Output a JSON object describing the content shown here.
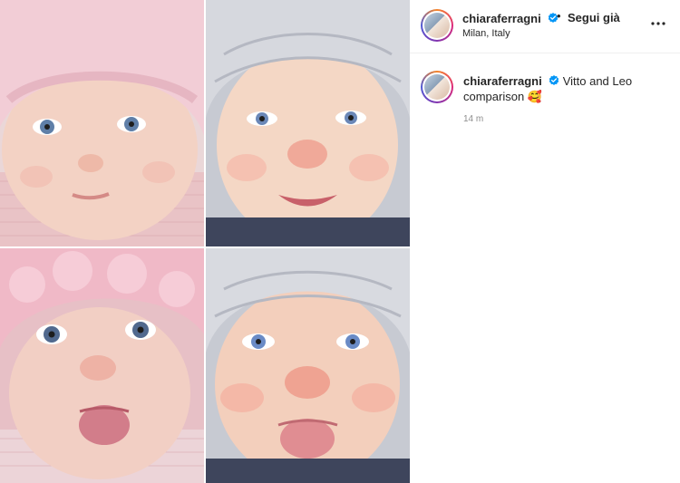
{
  "post": {
    "username": "chiaraferragni",
    "follow_label": "Segui già",
    "separator": "•",
    "location": "Milan, Italy",
    "caption_text": "Vitto and Leo comparison",
    "caption_emoji": "🥰",
    "timestamp": "14 m",
    "more_label": "..."
  },
  "icons": {
    "verified": "verified-badge-icon",
    "more": "more-options-icon"
  },
  "colors": {
    "verified_blue": "#0095f6",
    "text": "#262626",
    "secondary_text": "#8e8e8e"
  }
}
